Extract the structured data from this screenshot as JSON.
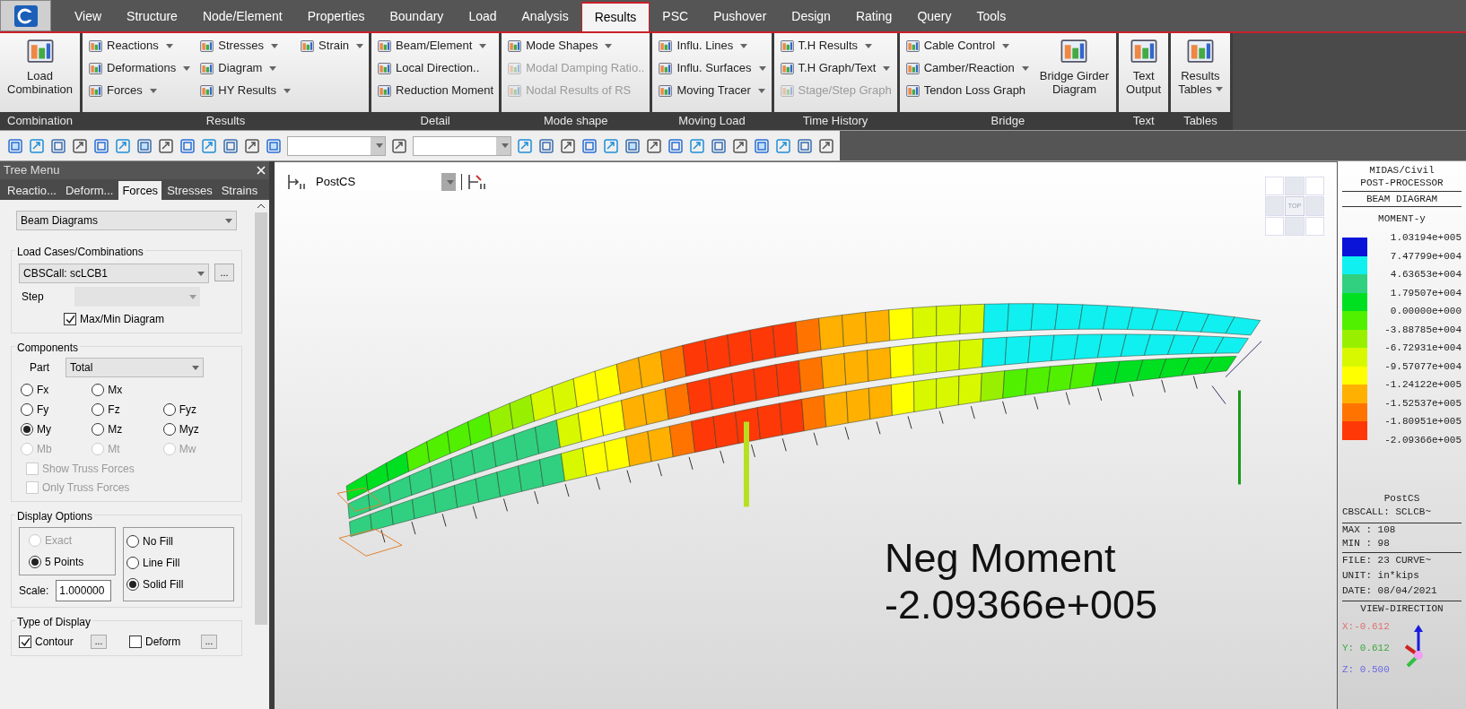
{
  "menu_tabs": [
    {
      "label": "View",
      "selected": false
    },
    {
      "label": "Structure",
      "selected": false
    },
    {
      "label": "Node/Element",
      "selected": false
    },
    {
      "label": "Properties",
      "selected": false
    },
    {
      "label": "Boundary",
      "selected": false
    },
    {
      "label": "Load",
      "selected": false
    },
    {
      "label": "Analysis",
      "selected": false
    },
    {
      "label": "Results",
      "selected": true
    },
    {
      "label": "PSC",
      "selected": false
    },
    {
      "label": "Pushover",
      "selected": false
    },
    {
      "label": "Design",
      "selected": false
    },
    {
      "label": "Rating",
      "selected": false
    },
    {
      "label": "Query",
      "selected": false
    },
    {
      "label": "Tools",
      "selected": false
    }
  ],
  "ribbon_groups": [
    {
      "label": "Combination",
      "columns": [
        [
          {
            "kind": "large",
            "lines": [
              "Load",
              "Combination"
            ],
            "dropdown": false,
            "disabled": false
          }
        ]
      ]
    },
    {
      "label": "Results",
      "columns": [
        [
          {
            "kind": "small",
            "label": "Reactions",
            "dropdown": true,
            "disabled": false
          },
          {
            "kind": "small",
            "label": "Deformations",
            "dropdown": true,
            "disabled": false
          },
          {
            "kind": "small",
            "label": "Forces",
            "dropdown": true,
            "disabled": false
          }
        ],
        [
          {
            "kind": "small",
            "label": "Stresses",
            "dropdown": true,
            "disabled": false
          },
          {
            "kind": "small",
            "label": "Diagram",
            "dropdown": true,
            "disabled": false
          },
          {
            "kind": "small",
            "label": "HY Results",
            "dropdown": true,
            "disabled": false
          }
        ],
        [
          {
            "kind": "small",
            "label": "Strain",
            "dropdown": true,
            "disabled": false
          }
        ]
      ]
    },
    {
      "label": "Detail",
      "columns": [
        [
          {
            "kind": "small",
            "label": "Beam/Element",
            "dropdown": true,
            "disabled": false
          },
          {
            "kind": "small",
            "label": "Local Direction..",
            "dropdown": false,
            "disabled": false
          },
          {
            "kind": "small",
            "label": "Reduction Moment",
            "dropdown": false,
            "disabled": false
          }
        ]
      ]
    },
    {
      "label": "Mode shape",
      "columns": [
        [
          {
            "kind": "small",
            "label": "Mode Shapes",
            "dropdown": true,
            "disabled": false
          },
          {
            "kind": "small",
            "label": "Modal Damping Ratio..",
            "dropdown": false,
            "disabled": true
          },
          {
            "kind": "small",
            "label": "Nodal Results of RS",
            "dropdown": false,
            "disabled": true
          }
        ]
      ]
    },
    {
      "label": "Moving Load",
      "columns": [
        [
          {
            "kind": "small",
            "label": "Influ. Lines",
            "dropdown": true,
            "disabled": false
          },
          {
            "kind": "small",
            "label": "Influ. Surfaces",
            "dropdown": true,
            "disabled": false
          },
          {
            "kind": "small",
            "label": "Moving Tracer",
            "dropdown": true,
            "disabled": false
          }
        ]
      ]
    },
    {
      "label": "Time History",
      "columns": [
        [
          {
            "kind": "small",
            "label": "T.H Results",
            "dropdown": true,
            "disabled": false
          },
          {
            "kind": "small",
            "label": "T.H Graph/Text",
            "dropdown": true,
            "disabled": false
          },
          {
            "kind": "small",
            "label": "Stage/Step Graph",
            "dropdown": false,
            "disabled": true
          }
        ]
      ]
    },
    {
      "label": "Bridge",
      "columns": [
        [
          {
            "kind": "small",
            "label": "Cable Control",
            "dropdown": true,
            "disabled": false
          },
          {
            "kind": "small",
            "label": "Camber/Reaction",
            "dropdown": true,
            "disabled": false
          },
          {
            "kind": "small",
            "label": "Tendon Loss Graph",
            "dropdown": false,
            "disabled": false
          }
        ],
        [
          {
            "kind": "large",
            "lines": [
              "Bridge Girder",
              "Diagram"
            ],
            "dropdown": false,
            "disabled": false
          }
        ]
      ]
    },
    {
      "label": "Text",
      "columns": [
        [
          {
            "kind": "large",
            "lines": [
              "Text",
              "Output"
            ],
            "dropdown": false,
            "disabled": false
          }
        ]
      ]
    },
    {
      "label": "Tables",
      "columns": [
        [
          {
            "kind": "large",
            "lines": [
              "Results",
              "Tables"
            ],
            "dropdown": true,
            "disabled": false
          }
        ]
      ]
    }
  ],
  "tree_menu": {
    "title": "Tree Menu",
    "tabs": [
      {
        "label": "Reactio...",
        "selected": false
      },
      {
        "label": "Deform...",
        "selected": false
      },
      {
        "label": "Forces",
        "selected": true
      },
      {
        "label": "Stresses",
        "selected": false
      },
      {
        "label": "Strains",
        "selected": false
      }
    ],
    "diagram_type": "Beam Diagrams",
    "load_cases": {
      "heading": "Load Cases/Combinations",
      "selection": "CBSCall: scLCB1",
      "browse": "...",
      "step_label": "Step",
      "maxmin": {
        "label": "Max/Min Diagram",
        "checked": true
      }
    },
    "components": {
      "heading": "Components",
      "part_label": "Part",
      "part": "Total",
      "rows": [
        [
          {
            "label": "Fx",
            "selected": false,
            "disabled": false
          },
          {
            "label": "Mx",
            "selected": false,
            "disabled": false
          }
        ],
        [
          {
            "label": "Fy",
            "selected": false,
            "disabled": false
          },
          {
            "label": "Fz",
            "selected": false,
            "disabled": false
          },
          {
            "label": "Fyz",
            "selected": false,
            "disabled": false
          }
        ],
        [
          {
            "label": "My",
            "selected": true,
            "disabled": false
          },
          {
            "label": "Mz",
            "selected": false,
            "disabled": false
          },
          {
            "label": "Myz",
            "selected": false,
            "disabled": false
          }
        ],
        [
          {
            "label": "Mb",
            "selected": false,
            "disabled": true
          },
          {
            "label": "Mt",
            "selected": false,
            "disabled": true
          },
          {
            "label": "Mw",
            "selected": false,
            "disabled": true
          }
        ]
      ],
      "options": [
        {
          "label": "Show Truss Forces",
          "checked": false,
          "disabled": true
        },
        {
          "label": "Only Truss Forces",
          "checked": false,
          "disabled": true
        }
      ]
    },
    "display_options": {
      "heading": "Display Options",
      "points": [
        {
          "label": "Exact",
          "selected": false,
          "disabled": true
        },
        {
          "label": "5 Points",
          "selected": true,
          "disabled": false
        }
      ],
      "scale_label": "Scale:",
      "scale": "1.000000",
      "fills": [
        {
          "label": "No Fill",
          "selected": false,
          "disabled": false
        },
        {
          "label": "Line Fill",
          "selected": false,
          "disabled": false
        },
        {
          "label": "Solid Fill",
          "selected": true,
          "disabled": false
        }
      ]
    },
    "type_of_display": {
      "heading": "Type of Display",
      "items": [
        {
          "label": "Contour",
          "checked": true,
          "more": "..."
        },
        {
          "label": "Deform",
          "checked": false,
          "more": "..."
        }
      ]
    }
  },
  "viewport": {
    "stage": "PostCS",
    "view_cube": "TOP",
    "annotation": [
      "Neg Moment",
      "-2.09366e+005"
    ]
  },
  "legend": {
    "header": [
      "MIDAS/Civil",
      "POST-PROCESSOR"
    ],
    "type": "BEAM DIAGRAM",
    "component": "MOMENT-y",
    "bands": [
      {
        "color": "#0a14d8"
      },
      {
        "color": "#10f0f0"
      },
      {
        "color": "#30d080"
      },
      {
        "color": "#00e020"
      },
      {
        "color": "#50f000"
      },
      {
        "color": "#98f000"
      },
      {
        "color": "#d8f800"
      },
      {
        "color": "#ffff00"
      },
      {
        "color": "#ffb000"
      },
      {
        "color": "#ff7400"
      },
      {
        "color": "#ff3808"
      }
    ],
    "ticks": [
      "1.03194e+005",
      "7.47799e+004",
      "4.63653e+004",
      "1.79507e+004",
      "0.00000e+000",
      "-3.88785e+004",
      "-6.72931e+004",
      "-9.57077e+004",
      "-1.24122e+005",
      "-1.52537e+005",
      "-1.80951e+005",
      "-2.09366e+005"
    ],
    "stage": "PostCS",
    "case": "CBSCALL: SCLCB~",
    "stats": [
      "MAX : 108",
      "MIN : 98"
    ],
    "info": [
      "FILE: 23 CURVE~",
      "UNIT: in*kips",
      "DATE: 08/04/2021"
    ],
    "view_direction": "VIEW-DIRECTION",
    "axes": [
      {
        "text": "X:-0.612",
        "color": "#e07070"
      },
      {
        "text": "Y: 0.612",
        "color": "#3ca83c"
      },
      {
        "text": "Z: 0.500",
        "color": "#6a6ae0"
      }
    ]
  }
}
